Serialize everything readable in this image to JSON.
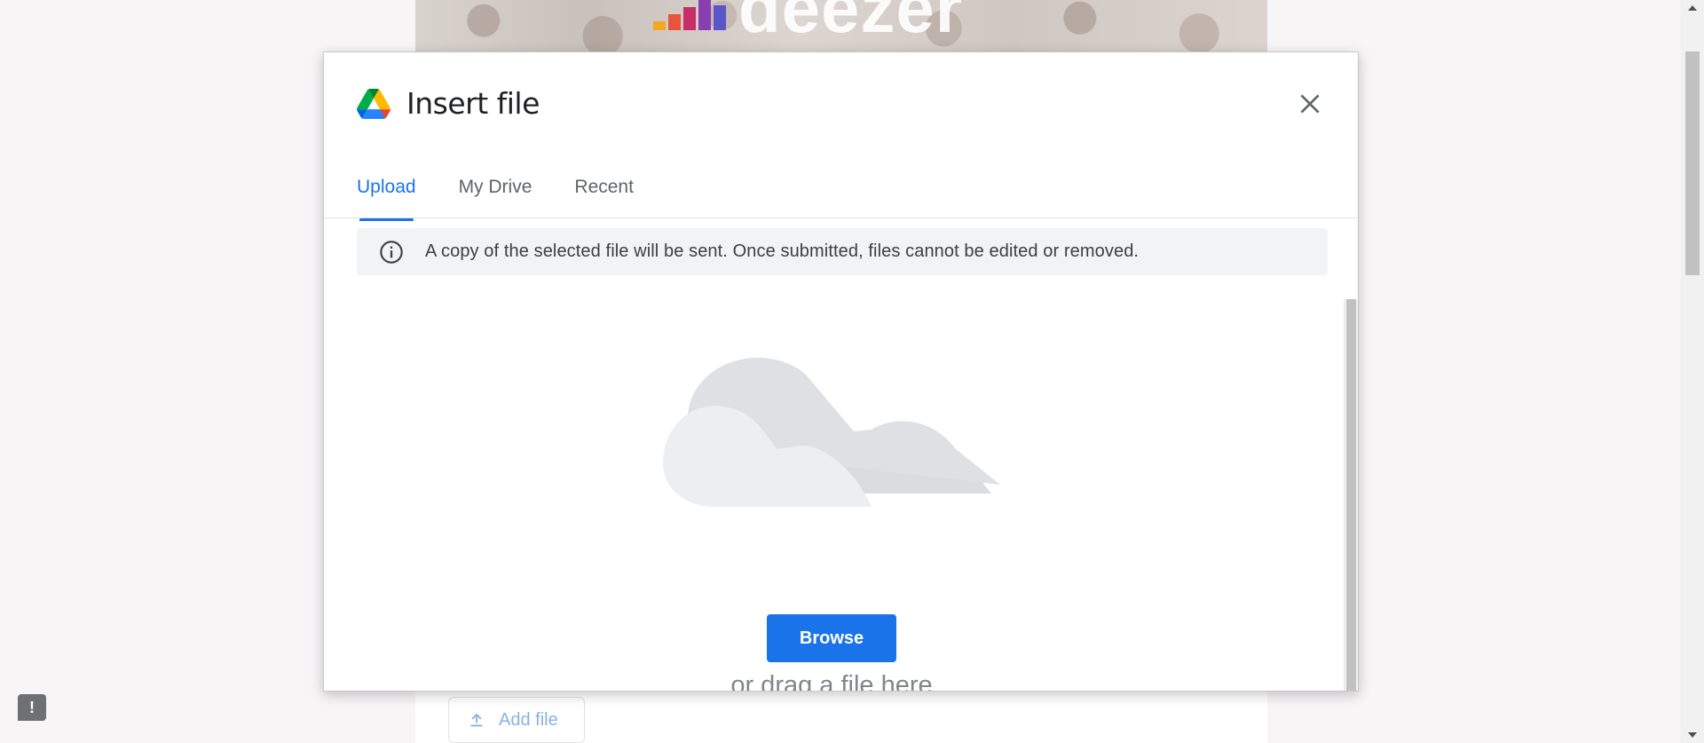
{
  "background": {
    "logo_text": "deezer",
    "add_file_label": "Add file",
    "report_icon": "exclamation-icon"
  },
  "dialog": {
    "title": "Insert file",
    "icons": {
      "brand": "google-drive-icon",
      "close": "close-icon",
      "info": "info-icon",
      "illustration": "cloud-illustration"
    },
    "tabs": [
      {
        "label": "Upload",
        "active": true
      },
      {
        "label": "My Drive",
        "active": false
      },
      {
        "label": "Recent",
        "active": false
      }
    ],
    "notice": "A copy of the selected file will be sent. Once submitted, files cannot be edited or removed.",
    "browse_label": "Browse",
    "drag_text": "or drag a file here"
  },
  "colors": {
    "accent": "#1a73e8",
    "text_primary": "#202124",
    "text_secondary": "#5f6368",
    "notice_bg": "#f1f3f4"
  }
}
